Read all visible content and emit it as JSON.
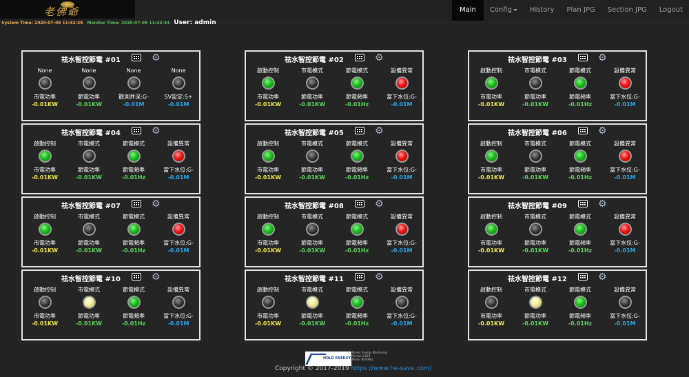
{
  "logo": {
    "text": "老佛爺"
  },
  "nav": [
    {
      "label": "Main",
      "active": true
    },
    {
      "label": "Config",
      "dropdown": true
    },
    {
      "label": "History"
    },
    {
      "label": "Plan JPG"
    },
    {
      "label": "Section JPG"
    },
    {
      "label": "Logout"
    }
  ],
  "status": {
    "system_time": "System Time: 2020-07-09 11:42:39",
    "monitor_time": "Monitor Time: 2020-07-09 11:42:34",
    "user": "User: admin"
  },
  "panels": [
    {
      "title": "祛水智控節電 #01",
      "cells": [
        {
          "top": "None",
          "lamp": "gray",
          "bottom": "市電功率",
          "value": "-0.01KW",
          "vcolor": "yellow"
        },
        {
          "top": "None",
          "lamp": "gray",
          "bottom": "節電功率",
          "value": "-0.01KW",
          "vcolor": "green"
        },
        {
          "top": "None",
          "lamp": "gray",
          "bottom": "觀測井深:G-",
          "value": "-0.01M",
          "vcolor": "blue"
        },
        {
          "top": "None",
          "lamp": "gray",
          "bottom": "SV設定:S+",
          "value": "-0.01M",
          "vcolor": "blue"
        }
      ]
    },
    {
      "title": "祛水智控節電 #02",
      "cells": [
        {
          "top": "啟動控制",
          "lamp": "green",
          "bottom": "市電功率",
          "value": "-0.01KW",
          "vcolor": "yellow"
        },
        {
          "top": "市電模式",
          "lamp": "gray",
          "bottom": "節電功率",
          "value": "-0.01KW",
          "vcolor": "green"
        },
        {
          "top": "節電模式",
          "lamp": "green",
          "bottom": "節電頻率",
          "value": "-0.01Hz",
          "vcolor": "green"
        },
        {
          "top": "設備異常",
          "lamp": "red",
          "bottom": "當下水位:G-",
          "value": "-0.01M",
          "vcolor": "blue"
        }
      ]
    },
    {
      "title": "祛水智控節電 #03",
      "cells": [
        {
          "top": "啟動控制",
          "lamp": "green",
          "bottom": "市電功率",
          "value": "-0.01KW",
          "vcolor": "yellow"
        },
        {
          "top": "市電模式",
          "lamp": "gray",
          "bottom": "節電功率",
          "value": "-0.01KW",
          "vcolor": "green"
        },
        {
          "top": "節電模式",
          "lamp": "green",
          "bottom": "節電頻率",
          "value": "-0.01Hz",
          "vcolor": "green"
        },
        {
          "top": "設備異常",
          "lamp": "red",
          "bottom": "當下水位:G-",
          "value": "-0.01M",
          "vcolor": "blue"
        }
      ]
    },
    {
      "title": "祛水智控節電 #04",
      "cells": [
        {
          "top": "啟動控制",
          "lamp": "green",
          "bottom": "市電功率",
          "value": "-0.01KW",
          "vcolor": "yellow"
        },
        {
          "top": "市電模式",
          "lamp": "gray",
          "bottom": "節電功率",
          "value": "-0.01KW",
          "vcolor": "green"
        },
        {
          "top": "節電模式",
          "lamp": "green",
          "bottom": "節電頻率",
          "value": "-0.01Hz",
          "vcolor": "green"
        },
        {
          "top": "設備異常",
          "lamp": "red",
          "bottom": "當下水位:G-",
          "value": "-0.01M",
          "vcolor": "blue"
        }
      ]
    },
    {
      "title": "祛水智控節電 #05",
      "cells": [
        {
          "top": "啟動控制",
          "lamp": "green",
          "bottom": "市電功率",
          "value": "-0.01KW",
          "vcolor": "yellow"
        },
        {
          "top": "市電模式",
          "lamp": "gray",
          "bottom": "節電功率",
          "value": "-0.01KW",
          "vcolor": "green"
        },
        {
          "top": "節電模式",
          "lamp": "green",
          "bottom": "節電頻率",
          "value": "-0.01Hz",
          "vcolor": "green"
        },
        {
          "top": "設備異常",
          "lamp": "red",
          "bottom": "當下水位:G-",
          "value": "-0.01M",
          "vcolor": "blue"
        }
      ]
    },
    {
      "title": "祛水智控節電 #06",
      "cells": [
        {
          "top": "啟動控制",
          "lamp": "green",
          "bottom": "市電功率",
          "value": "-0.01KW",
          "vcolor": "yellow"
        },
        {
          "top": "市電模式",
          "lamp": "gray",
          "bottom": "節電功率",
          "value": "-0.01KW",
          "vcolor": "green"
        },
        {
          "top": "節電模式",
          "lamp": "green",
          "bottom": "節電頻率",
          "value": "-0.01Hz",
          "vcolor": "green"
        },
        {
          "top": "設備異常",
          "lamp": "red",
          "bottom": "當下水位:G-",
          "value": "-0.01M",
          "vcolor": "blue"
        }
      ]
    },
    {
      "title": "祛水智控節電 #07",
      "cells": [
        {
          "top": "啟動控制",
          "lamp": "green",
          "bottom": "市電功率",
          "value": "-0.01KW",
          "vcolor": "yellow"
        },
        {
          "top": "市電模式",
          "lamp": "gray",
          "bottom": "節電功率",
          "value": "-0.01KW",
          "vcolor": "green"
        },
        {
          "top": "節電模式",
          "lamp": "green",
          "bottom": "節電頻率",
          "value": "-0.01Hz",
          "vcolor": "green"
        },
        {
          "top": "設備異常",
          "lamp": "red",
          "bottom": "當下水位:G-",
          "value": "-0.01M",
          "vcolor": "blue"
        }
      ]
    },
    {
      "title": "祛水智控節電 #08",
      "cells": [
        {
          "top": "啟動控制",
          "lamp": "green",
          "bottom": "市電功率",
          "value": "-0.01KW",
          "vcolor": "yellow"
        },
        {
          "top": "市電模式",
          "lamp": "gray",
          "bottom": "節電功率",
          "value": "-0.01KW",
          "vcolor": "green"
        },
        {
          "top": "節電模式",
          "lamp": "green",
          "bottom": "節電頻率",
          "value": "-0.01Hz",
          "vcolor": "green"
        },
        {
          "top": "設備異常",
          "lamp": "red",
          "bottom": "當下水位:G-",
          "value": "-0.01M",
          "vcolor": "blue"
        }
      ]
    },
    {
      "title": "祛水智控節電 #09",
      "cells": [
        {
          "top": "啟動控制",
          "lamp": "green",
          "bottom": "市電功率",
          "value": "-0.01KW",
          "vcolor": "yellow"
        },
        {
          "top": "市電模式",
          "lamp": "gray",
          "bottom": "節電功率",
          "value": "-0.01KW",
          "vcolor": "green"
        },
        {
          "top": "節電模式",
          "lamp": "green",
          "bottom": "節電頻率",
          "value": "-0.01Hz",
          "vcolor": "green"
        },
        {
          "top": "設備異常",
          "lamp": "red",
          "bottom": "當下水位:G-",
          "value": "-0.01M",
          "vcolor": "blue"
        }
      ]
    },
    {
      "title": "祛水智控節電 #10",
      "cells": [
        {
          "top": "啟動控制",
          "lamp": "gray",
          "bottom": "市電功率",
          "value": "-0.01KW",
          "vcolor": "yellow"
        },
        {
          "top": "市電模式",
          "lamp": "yellow",
          "bottom": "節電功率",
          "value": "-0.01KW",
          "vcolor": "green"
        },
        {
          "top": "節電模式",
          "lamp": "green",
          "bottom": "節電頻率",
          "value": "-0.01Hz",
          "vcolor": "green"
        },
        {
          "top": "設備異常",
          "lamp": "gray",
          "bottom": "當下水位:G-",
          "value": "-0.01M",
          "vcolor": "blue"
        }
      ]
    },
    {
      "title": "祛水智控節電 #11",
      "cells": [
        {
          "top": "啟動控制",
          "lamp": "gray",
          "bottom": "市電功率",
          "value": "-0.01KW",
          "vcolor": "yellow"
        },
        {
          "top": "市電模式",
          "lamp": "yellow",
          "bottom": "節電功率",
          "value": "-0.01KW",
          "vcolor": "green"
        },
        {
          "top": "節電模式",
          "lamp": "green",
          "bottom": "節電頻率",
          "value": "-0.01Hz",
          "vcolor": "green"
        },
        {
          "top": "設備異常",
          "lamp": "gray",
          "bottom": "當下水位:G-",
          "value": "-0.01M",
          "vcolor": "blue"
        }
      ]
    },
    {
      "title": "祛水智控節電 #12",
      "cells": [
        {
          "top": "啟動控制",
          "lamp": "gray",
          "bottom": "市電功率",
          "value": "-0.01KW",
          "vcolor": "yellow"
        },
        {
          "top": "市電模式",
          "lamp": "yellow",
          "bottom": "節電功率",
          "value": "-0.01KW",
          "vcolor": "green"
        },
        {
          "top": "節電模式",
          "lamp": "green",
          "bottom": "節電頻率",
          "value": "-0.01Hz",
          "vcolor": "green"
        },
        {
          "top": "設備異常",
          "lamp": "gray",
          "bottom": "當下水位:G-",
          "value": "-0.01M",
          "vcolor": "blue"
        }
      ]
    }
  ],
  "footer": {
    "logo_text": "HOLD ENERGY",
    "meta": [
      "Name: Energy Monitoring",
      "Version:2019",
      "Mode: NORMAL"
    ],
    "copyright": "Copyright © 2017-2019",
    "link": "https://www.he-save.com/"
  },
  "colors": {
    "background": "#242424",
    "panel_border": "#e5e5e5",
    "value_yellow": "#f0e54a",
    "value_green": "#5cd65c",
    "value_blue": "#2aa7e8",
    "system_time": "#f0ad4e",
    "monitor_time": "#5cb85c"
  },
  "icons": {
    "panel_grid": "grid-icon",
    "panel_settings": "gear-icon"
  }
}
